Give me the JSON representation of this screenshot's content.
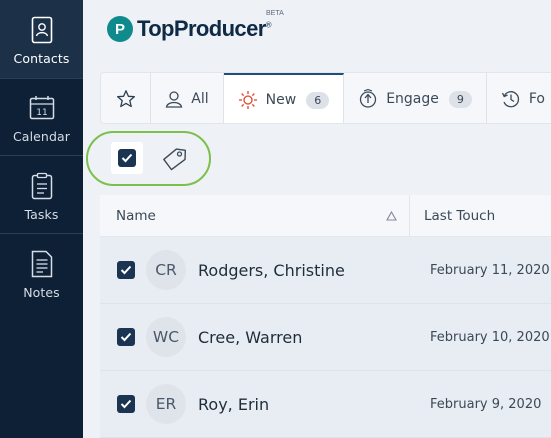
{
  "sidebar": {
    "items": [
      {
        "label": "Contacts",
        "icon": "contacts-icon",
        "active": true
      },
      {
        "label": "Calendar",
        "icon": "calendar-icon",
        "active": false,
        "calendar_day": "11"
      },
      {
        "label": "Tasks",
        "icon": "tasks-icon",
        "active": false
      },
      {
        "label": "Notes",
        "icon": "notes-icon",
        "active": false
      }
    ]
  },
  "header": {
    "logo_text": "TopProducer",
    "logo_mark": "P",
    "logo_suffix": "®",
    "beta": "BETA"
  },
  "tabs": [
    {
      "label": "",
      "icon": "star-icon"
    },
    {
      "label": "All",
      "icon": "person-icon"
    },
    {
      "label": "New",
      "icon": "sun-icon",
      "count": "6",
      "active": true
    },
    {
      "label": "Engage",
      "icon": "engage-icon",
      "count": "9"
    },
    {
      "label": "Fo",
      "icon": "history-icon"
    }
  ],
  "table": {
    "columns": [
      "Name",
      "Last Touch"
    ],
    "rows": [
      {
        "initials": "CR",
        "name": "Rodgers, Christine",
        "last_touch": "February 11, 2020",
        "checked": true
      },
      {
        "initials": "WC",
        "name": "Cree, Warren",
        "last_touch": "February 10, 2020",
        "checked": true
      },
      {
        "initials": "ER",
        "name": "Roy, Erin",
        "last_touch": "February 9, 2020",
        "checked": true
      }
    ]
  },
  "colors": {
    "sidebar_bg": "#0e2035",
    "sidebar_active": "#1c3048",
    "accent_green": "#7cc04b",
    "brand_teal": "#0f8a8d",
    "checkbox": "#1a3451"
  }
}
